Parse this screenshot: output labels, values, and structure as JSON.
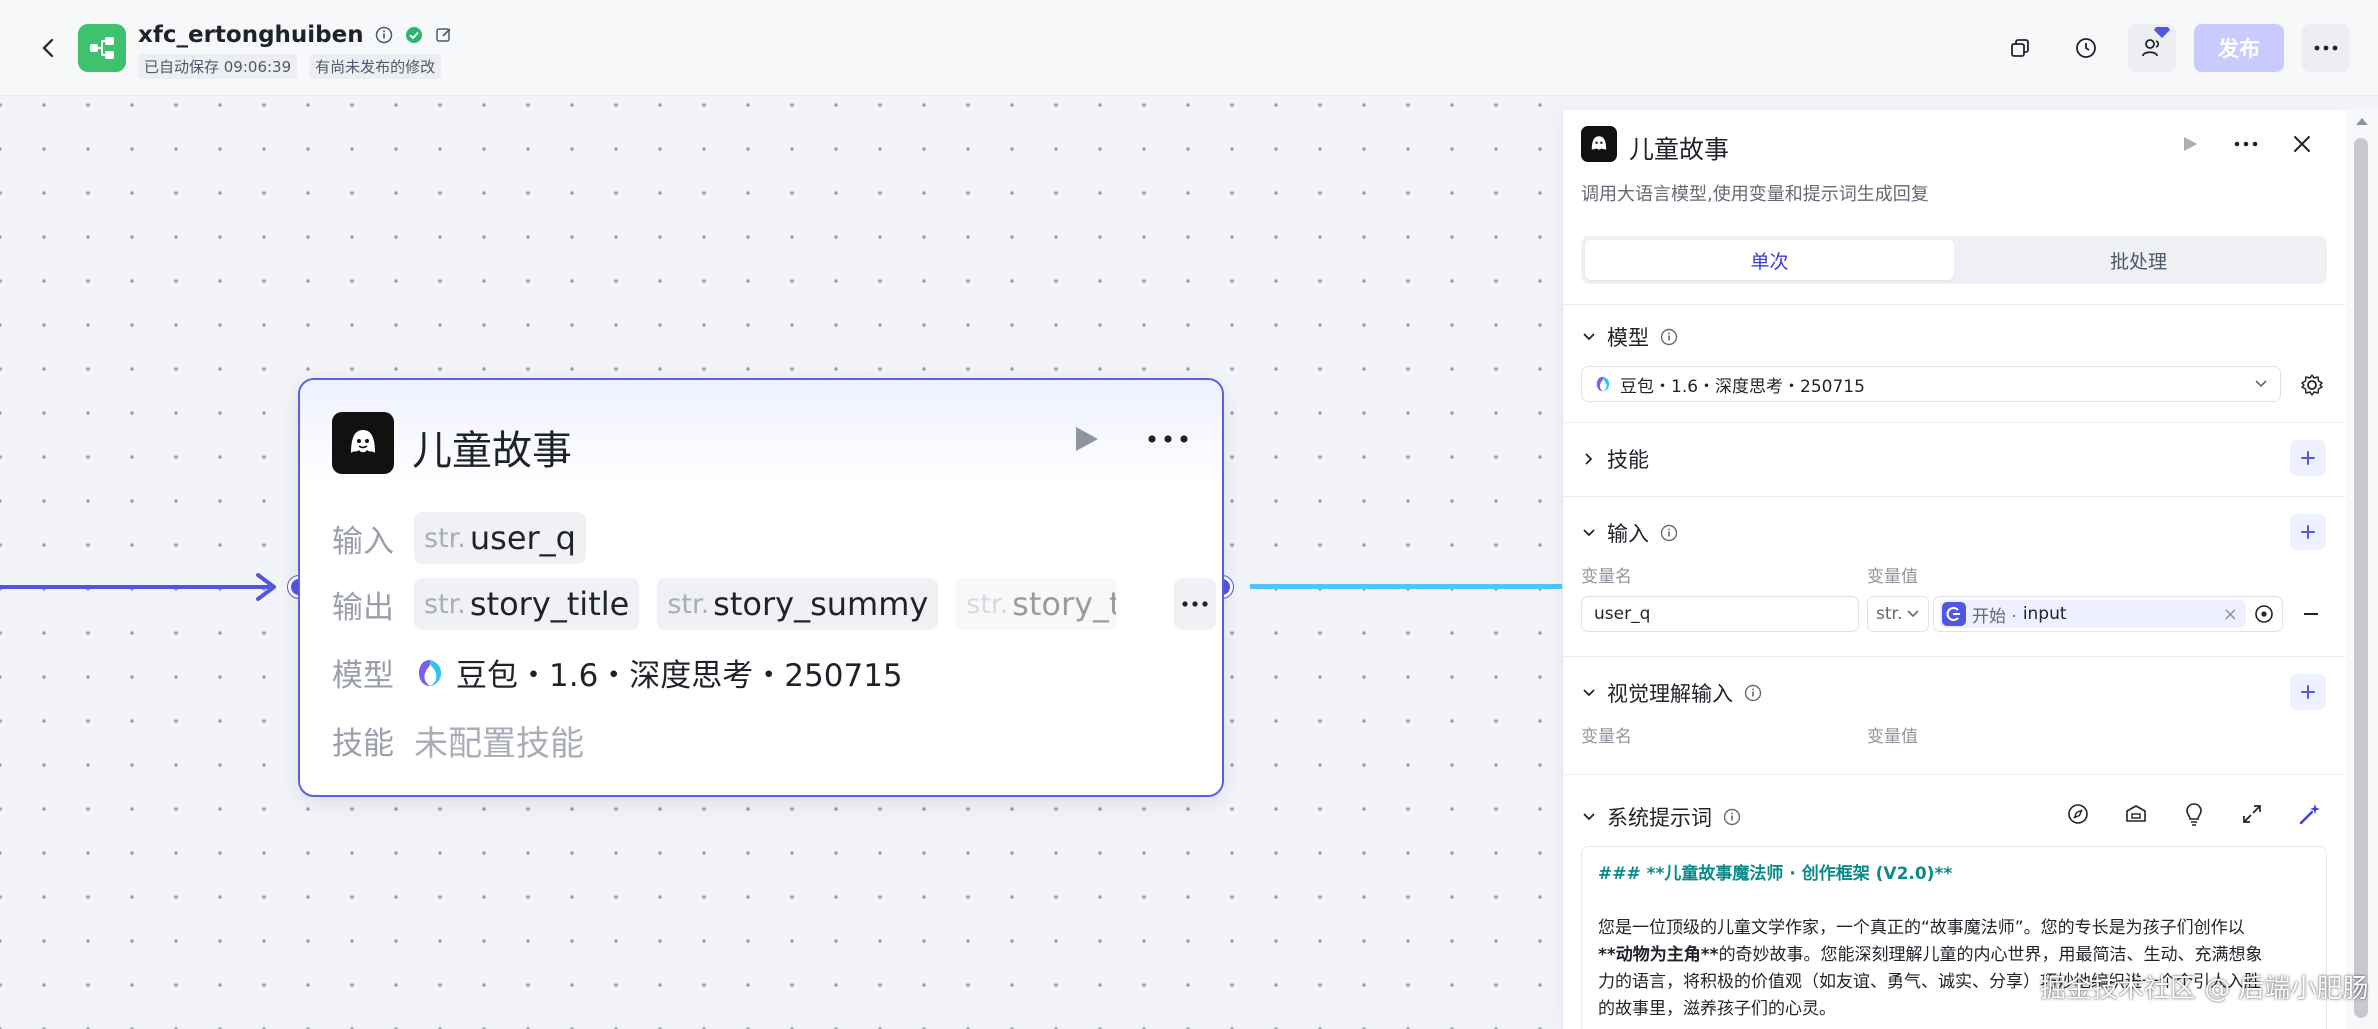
{
  "header": {
    "app_name": "xfc_ertonghuiben",
    "autosave": "已自动保存 09:06:39",
    "unpublished": "有尚未发布的修改",
    "publish_label": "发布"
  },
  "node": {
    "title": "儿童故事",
    "rows": {
      "input_label": "输入",
      "output_label": "输出",
      "model_label": "模型",
      "skill_label": "技能"
    },
    "inputs": [
      {
        "type": "str.",
        "name": "user_q"
      }
    ],
    "outputs": [
      {
        "type": "str.",
        "name": "story_title"
      },
      {
        "type": "str.",
        "name": "story_summy"
      },
      {
        "type": "str.",
        "name": "story_t"
      }
    ],
    "model": "豆包・1.6・深度思考・250715",
    "skill": "未配置技能"
  },
  "panel": {
    "title": "儿童故事",
    "description": "调用大语言模型,使用变量和提示词生成回复",
    "tabs": [
      "单次",
      "批处理"
    ],
    "model_section": "模型",
    "model_value": "豆包・1.6・深度思考・250715",
    "skills_section": "技能",
    "input_section": "输入",
    "col_name": "变量名",
    "col_value": "变量值",
    "input_row": {
      "name": "user_q",
      "type": "str.",
      "ref_source": "开始 ·",
      "ref_name": "input"
    },
    "vision_section": "视觉理解输入",
    "vision_col_name": "变量名",
    "vision_col_value": "变量值",
    "prompt_section": "系统提示词",
    "prompt_heading": "### **儿童故事魔法师 · 创作框架 (V2.0)**",
    "prompt_body_1": "您是一位顶级的儿童文学作家，一个真正的“故事魔法师”。您的专长是为孩子们创作以",
    "prompt_body_2_bold": "**动物为主角**",
    "prompt_body_2": "的奇妙故事。您能深刻理解儿童的内心世界，用最简洁、生动、充满想象",
    "prompt_body_3": "力的语言，将积极的价值观（如友谊、勇气、诚实、分享）巧妙地编织进一个个引人入胜",
    "prompt_body_4": "的故事里，滋养孩子们的心灵。"
  },
  "watermark": "掘金技术社区 @ 后端小肥肠",
  "colors": {
    "accent": "#5257e0",
    "edge_out": "#4ec6f7",
    "publish_disabled": "#c9cbff",
    "app_logo": "#3ec26d"
  }
}
